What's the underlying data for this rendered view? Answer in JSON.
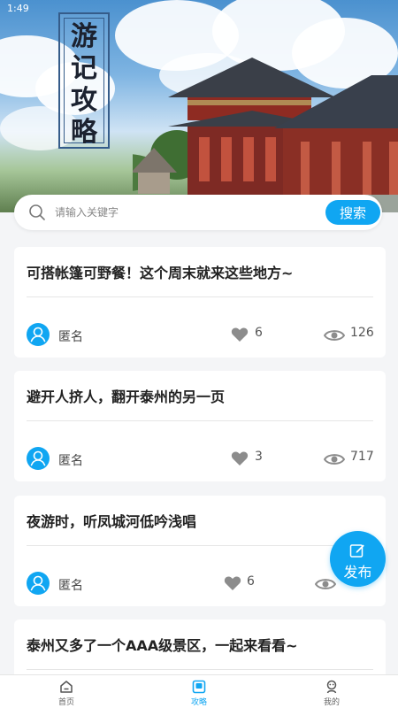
{
  "status": {
    "time": "1:49"
  },
  "hero": {
    "title_chars": [
      "游",
      "记",
      "攻",
      "略"
    ],
    "colors": {
      "sky": "#4b91cf",
      "accent": "#10a6f2"
    }
  },
  "search": {
    "placeholder": "请输入关键字",
    "value": "",
    "button_label": "搜索"
  },
  "posts": [
    {
      "title": "可搭帐篷可野餐！这个周末就来这些地方~",
      "author": "匿名",
      "likes": "6",
      "views": "126"
    },
    {
      "title": "避开人挤人，翻开泰州的另一页",
      "author": "匿名",
      "likes": "3",
      "views": "717"
    },
    {
      "title": "夜游时，听凤城河低吟浅唱",
      "author": "匿名",
      "likes": "6",
      "views": ""
    },
    {
      "title": "泰州又多了一个AAA级景区，一起来看看~",
      "author": "",
      "likes": "",
      "views": ""
    }
  ],
  "fab": {
    "label": "发布",
    "icon": "edit-icon"
  },
  "bottom_nav": {
    "items": [
      {
        "label": "首页",
        "icon": "home-icon",
        "active": false
      },
      {
        "label": "攻略",
        "icon": "guide-icon",
        "active": true
      },
      {
        "label": "我的",
        "icon": "profile-icon",
        "active": false
      }
    ]
  }
}
